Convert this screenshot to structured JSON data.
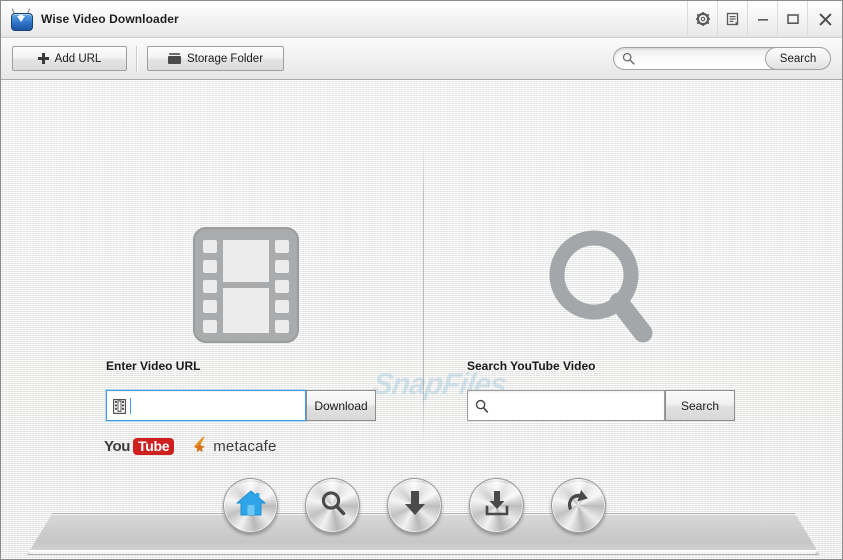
{
  "window": {
    "title": "Wise Video Downloader",
    "app_icon": "tv-download-icon",
    "controls": [
      {
        "name": "settings-gear-button",
        "icon": "gear-icon"
      },
      {
        "name": "download-list-button",
        "icon": "list-document-icon"
      },
      {
        "name": "minimize-button",
        "icon": "minimize-icon"
      },
      {
        "name": "maximize-button",
        "icon": "maximize-icon"
      },
      {
        "name": "close-button",
        "icon": "close-icon"
      }
    ]
  },
  "toolbar": {
    "add_url_label": "Add URL",
    "storage_folder_label": "Storage Folder",
    "search": {
      "value": "",
      "placeholder": "",
      "button_label": "Search"
    }
  },
  "main": {
    "watermark": "SnapFiles",
    "url_panel": {
      "icon": "film-strip-icon",
      "label": "Enter Video URL",
      "input_value": "",
      "input_placeholder": "",
      "input_icon": "film-strip-small-icon",
      "download_label": "Download",
      "supported_sites": [
        {
          "name": "youtube-logo",
          "part1": "You",
          "part2": "Tube",
          "color": "#cf2020"
        },
        {
          "name": "metacafe-logo",
          "text": "metacafe",
          "color": "#e8921d"
        }
      ]
    },
    "search_panel": {
      "icon": "magnifier-icon",
      "label": "Search YouTube Video",
      "input_value": "",
      "input_placeholder": "",
      "input_icon": "magnifier-small-icon",
      "search_label": "Search"
    }
  },
  "dock": {
    "buttons": [
      {
        "name": "dock-home-button",
        "icon": "home-icon",
        "color": "#2fa4e7"
      },
      {
        "name": "dock-search-button",
        "icon": "magnifier-icon",
        "color": "#4a4a4a"
      },
      {
        "name": "dock-download-button",
        "icon": "down-arrow-icon",
        "color": "#4a4a4a"
      },
      {
        "name": "dock-downloaded-button",
        "icon": "download-tray-icon",
        "color": "#4a4a4a"
      },
      {
        "name": "dock-convert-button",
        "icon": "rotate-arrow-icon",
        "color": "#4a4a4a"
      }
    ]
  },
  "colors": {
    "accent": "#2fa4e7",
    "focus_border": "#4a9ddd",
    "youtube_red": "#cf2020",
    "metacafe_orange": "#e8921d",
    "window_bg": "#f4f4f3"
  }
}
